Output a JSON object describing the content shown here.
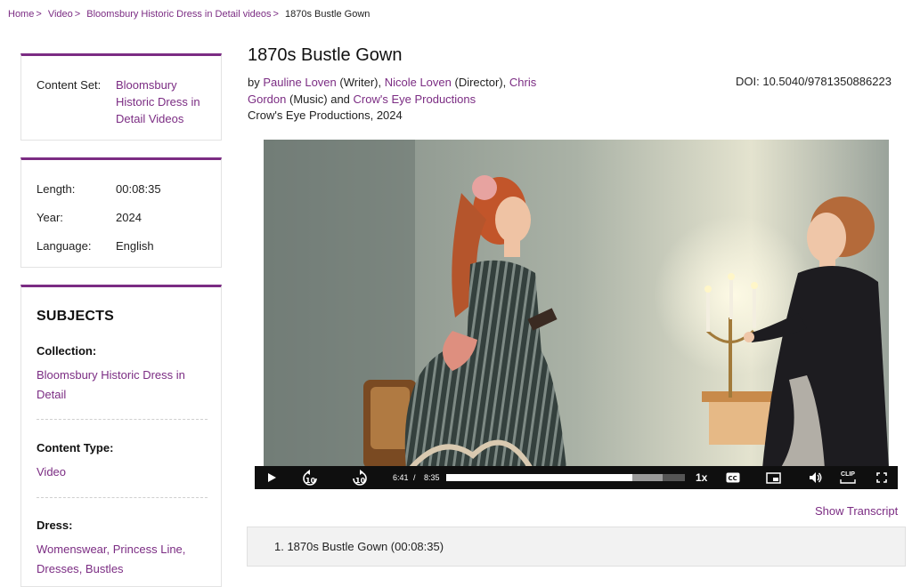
{
  "breadcrumb": {
    "items": [
      "Home",
      "Video",
      "Bloomsbury Historic Dress in Detail videos"
    ],
    "current": "1870s Bustle Gown"
  },
  "sidebar": {
    "content_set": {
      "label": "Content Set:",
      "value": "Bloomsbury Historic Dress in Detail Videos"
    },
    "details": [
      {
        "label": "Length:",
        "value": "00:08:35"
      },
      {
        "label": "Year:",
        "value": "2024"
      },
      {
        "label": "Language:",
        "value": "English"
      }
    ],
    "subjects": {
      "title": "SUBJECTS",
      "collection_label": "Collection:",
      "collection_value": "Bloomsbury Historic Dress in Detail",
      "content_type_label": "Content Type:",
      "content_type_value": "Video",
      "dress_label": "Dress:",
      "dress_values": [
        "Womenswear",
        "Princess Line",
        "Dresses",
        "Bustles"
      ]
    }
  },
  "main": {
    "title": "1870s Bustle Gown",
    "byline": {
      "prefix": "by",
      "contributors": [
        {
          "name": "Pauline Loven",
          "role": "(Writer),"
        },
        {
          "name": "Nicole Loven",
          "role": "(Director),"
        },
        {
          "name": "Chris Gordon",
          "role": "(Music) and"
        },
        {
          "name": "Crow's Eye Productions",
          "role": ""
        }
      ]
    },
    "publisher": "Crow's Eye Productions, 2024",
    "doi": "DOI: 10.5040/9781350886223"
  },
  "player": {
    "current_time": "6:41",
    "separator": "/",
    "duration": "8:35",
    "progress": 0.778,
    "buffered": 0.905,
    "speed": "1x",
    "clip_label": "CLIP"
  },
  "transcript": {
    "label": "Show Transcript"
  },
  "chapters": [
    {
      "label": "1. 1870s Bustle Gown (00:08:35)"
    }
  ],
  "colors": {
    "accent": "#7b2c83",
    "controls_bg": "#0f0f0f"
  }
}
